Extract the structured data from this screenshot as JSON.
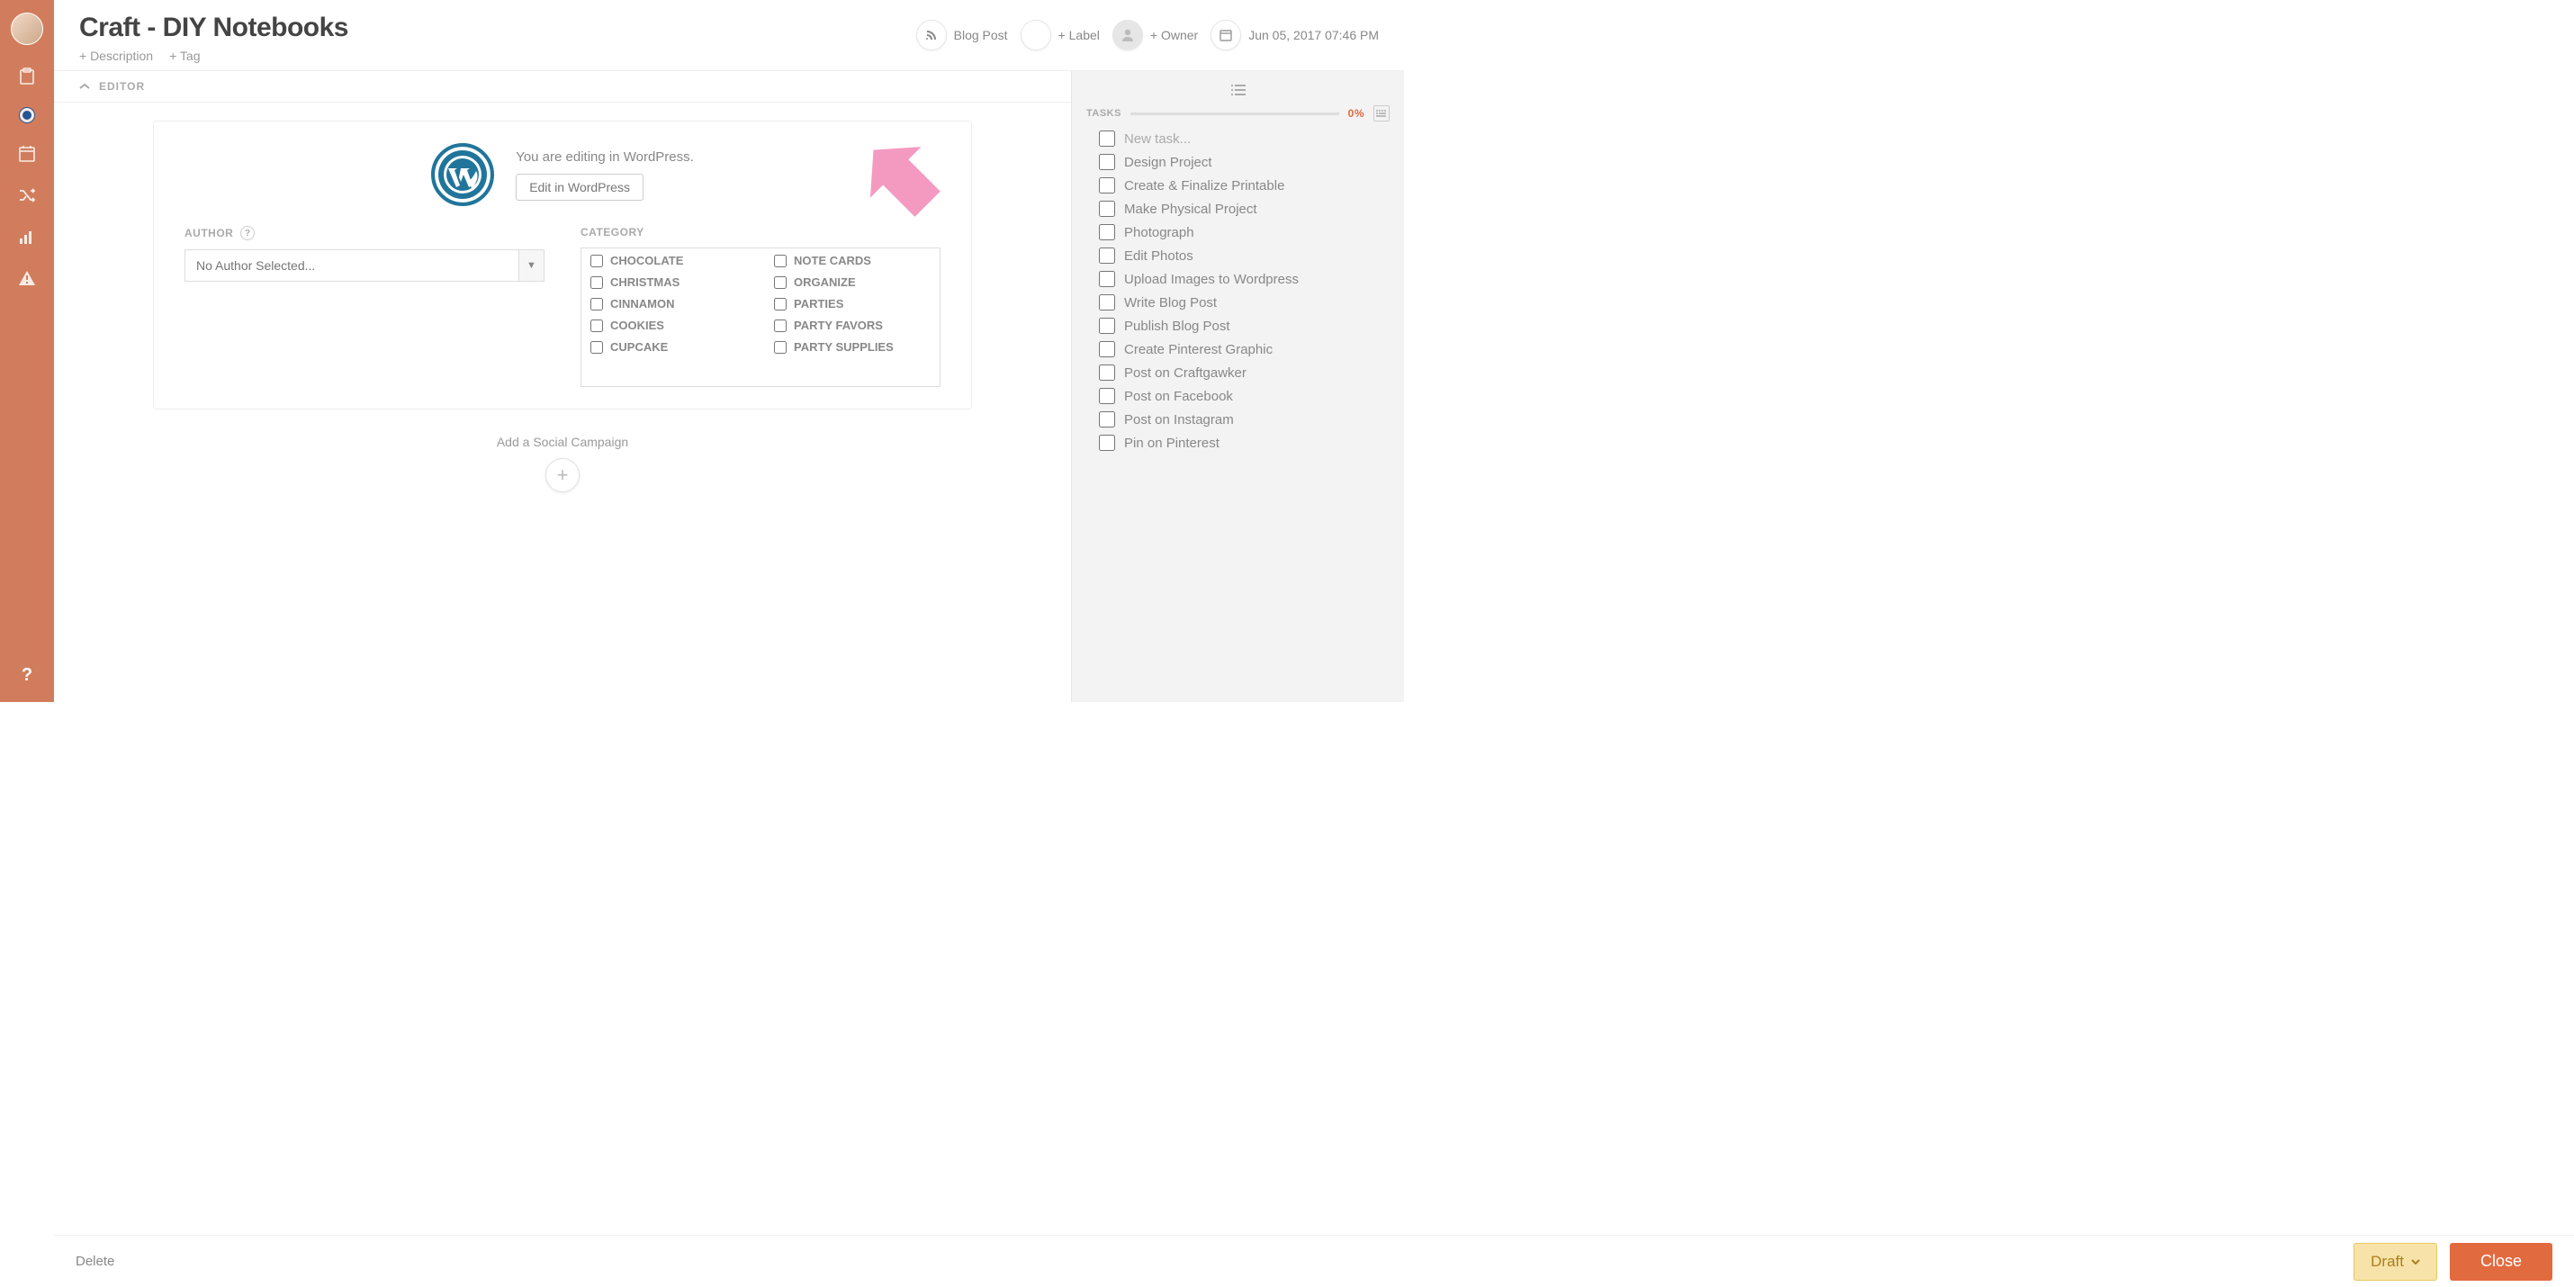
{
  "header": {
    "title": "Craft - DIY Notebooks",
    "add_description": "+ Description",
    "add_tag": "+ Tag",
    "post_type": "Blog Post",
    "add_label": "+ Label",
    "add_owner": "+ Owner",
    "datetime": "Jun 05, 2017 07:46 PM"
  },
  "section": {
    "editor_label": "EDITOR"
  },
  "wp": {
    "message": "You are editing in WordPress.",
    "button": "Edit in WordPress"
  },
  "author": {
    "label": "AUTHOR",
    "placeholder": "No Author Selected..."
  },
  "category": {
    "label": "CATEGORY",
    "left": [
      "CHOCOLATE",
      "CHRISTMAS",
      "CINNAMON",
      "COOKIES",
      "CUPCAKE"
    ],
    "right": [
      "NOTE CARDS",
      "ORGANIZE",
      "PARTIES",
      "PARTY FAVORS",
      "PARTY SUPPLIES"
    ]
  },
  "social": {
    "label": "Add a Social Campaign"
  },
  "tasks": {
    "heading": "TASKS",
    "percent": "0%",
    "new_task": "New task...",
    "items": [
      "Design Project",
      "Create & Finalize Printable",
      "Make Physical Project",
      "Photograph",
      "Edit Photos",
      "Upload Images to Wordpress",
      "Write Blog Post",
      "Publish Blog Post",
      "Create Pinterest Graphic",
      "Post on Craftgawker",
      "Post on Facebook",
      "Post on Instagram",
      " Pin on Pinterest"
    ]
  },
  "footer": {
    "delete": "Delete",
    "draft": "Draft",
    "close": "Close"
  }
}
